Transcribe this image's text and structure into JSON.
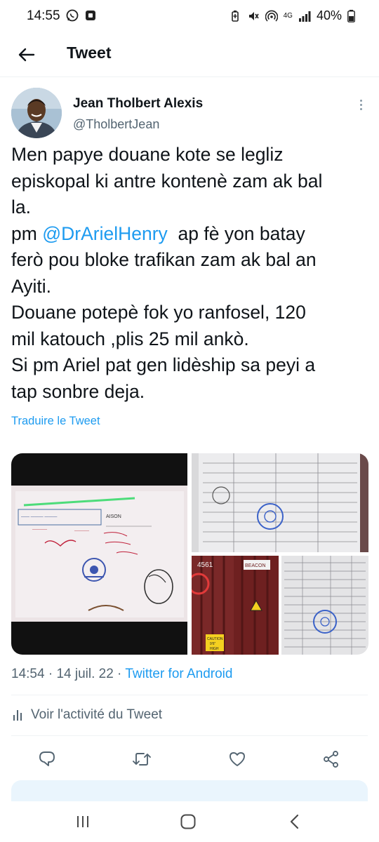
{
  "status_bar": {
    "time": "14:55",
    "network": "4G",
    "battery": "40%",
    "icons": [
      "whatsapp-icon",
      "app-notification-icon",
      "battery-saver-icon",
      "mute-icon",
      "hotspot-icon",
      "signal-icon",
      "battery-icon"
    ]
  },
  "header": {
    "title": "Tweet",
    "back_icon": "arrow-left-icon"
  },
  "author": {
    "name": "Jean Tholbert Alexis",
    "handle": "@TholbertJean"
  },
  "tweet": {
    "lines": [
      "Men papye douane kote se legliz",
      "episkopal ki antre kontenè zam ak bal",
      "la.",
      "ap fè yon batay",
      "ferò pou bloke trafikan zam ak bal an",
      "Ayiti.",
      "Douane potepè fok yo ranfosel, 120",
      "mil katouch ,plis 25 mil ankò.",
      "Si pm Ariel pat gen lidèship sa peyi a",
      "tap sonbre deja."
    ],
    "pm_prefix": "pm",
    "mention": "@DrArielHenry"
  },
  "translate_label": "Traduire le Tweet",
  "media": {
    "photo_1_stamp_text": "AISON",
    "photo_3_text_1": "4561",
    "photo_3_text_2": "BEACON",
    "photo_3_text_3": "CAUTION",
    "photo_3_text_4": "9'6\"",
    "photo_3_text_5": "HIGH"
  },
  "meta": {
    "time": "14:54",
    "separator": " · ",
    "date": "14 juil. 22",
    "client": "Twitter for Android"
  },
  "activity_label": "Voir l'activité du Tweet",
  "actions": {
    "reply_icon": "reply-icon",
    "retweet_icon": "retweet-icon",
    "like_icon": "heart-icon",
    "share_icon": "share-icon"
  },
  "nav_bar": {
    "recents_icon": "recents-icon",
    "home_icon": "home-icon",
    "back_icon": "back-chevron-icon"
  },
  "colors": {
    "accent": "#1d9bf0",
    "text": "#0f1419",
    "secondary": "#536471"
  }
}
